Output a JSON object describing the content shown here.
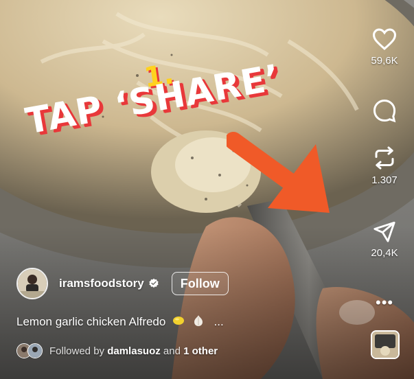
{
  "overlay": {
    "step_number": "1.",
    "headline": "TAP ‘SHARE’"
  },
  "rail": {
    "like_count": "59,6K",
    "repost_count": "1.307",
    "share_count": "20,4K",
    "more_label": "•••"
  },
  "author": {
    "username": "iramsfoodstory",
    "follow_label": "Follow"
  },
  "caption": {
    "text": "Lemon garlic chicken Alfredo",
    "ellipsis": "..."
  },
  "followed_by": {
    "prefix": "Followed by ",
    "name": "damlasuoz",
    "joiner": " and ",
    "other": "1 other"
  },
  "colors": {
    "headline_shadow": "#e8383a",
    "step_number": "#ffd21f",
    "arrow": "#f05a28"
  },
  "icons": [
    "heart-icon",
    "comment-icon",
    "repost-icon",
    "send-icon",
    "verified-icon",
    "more-icon"
  ]
}
